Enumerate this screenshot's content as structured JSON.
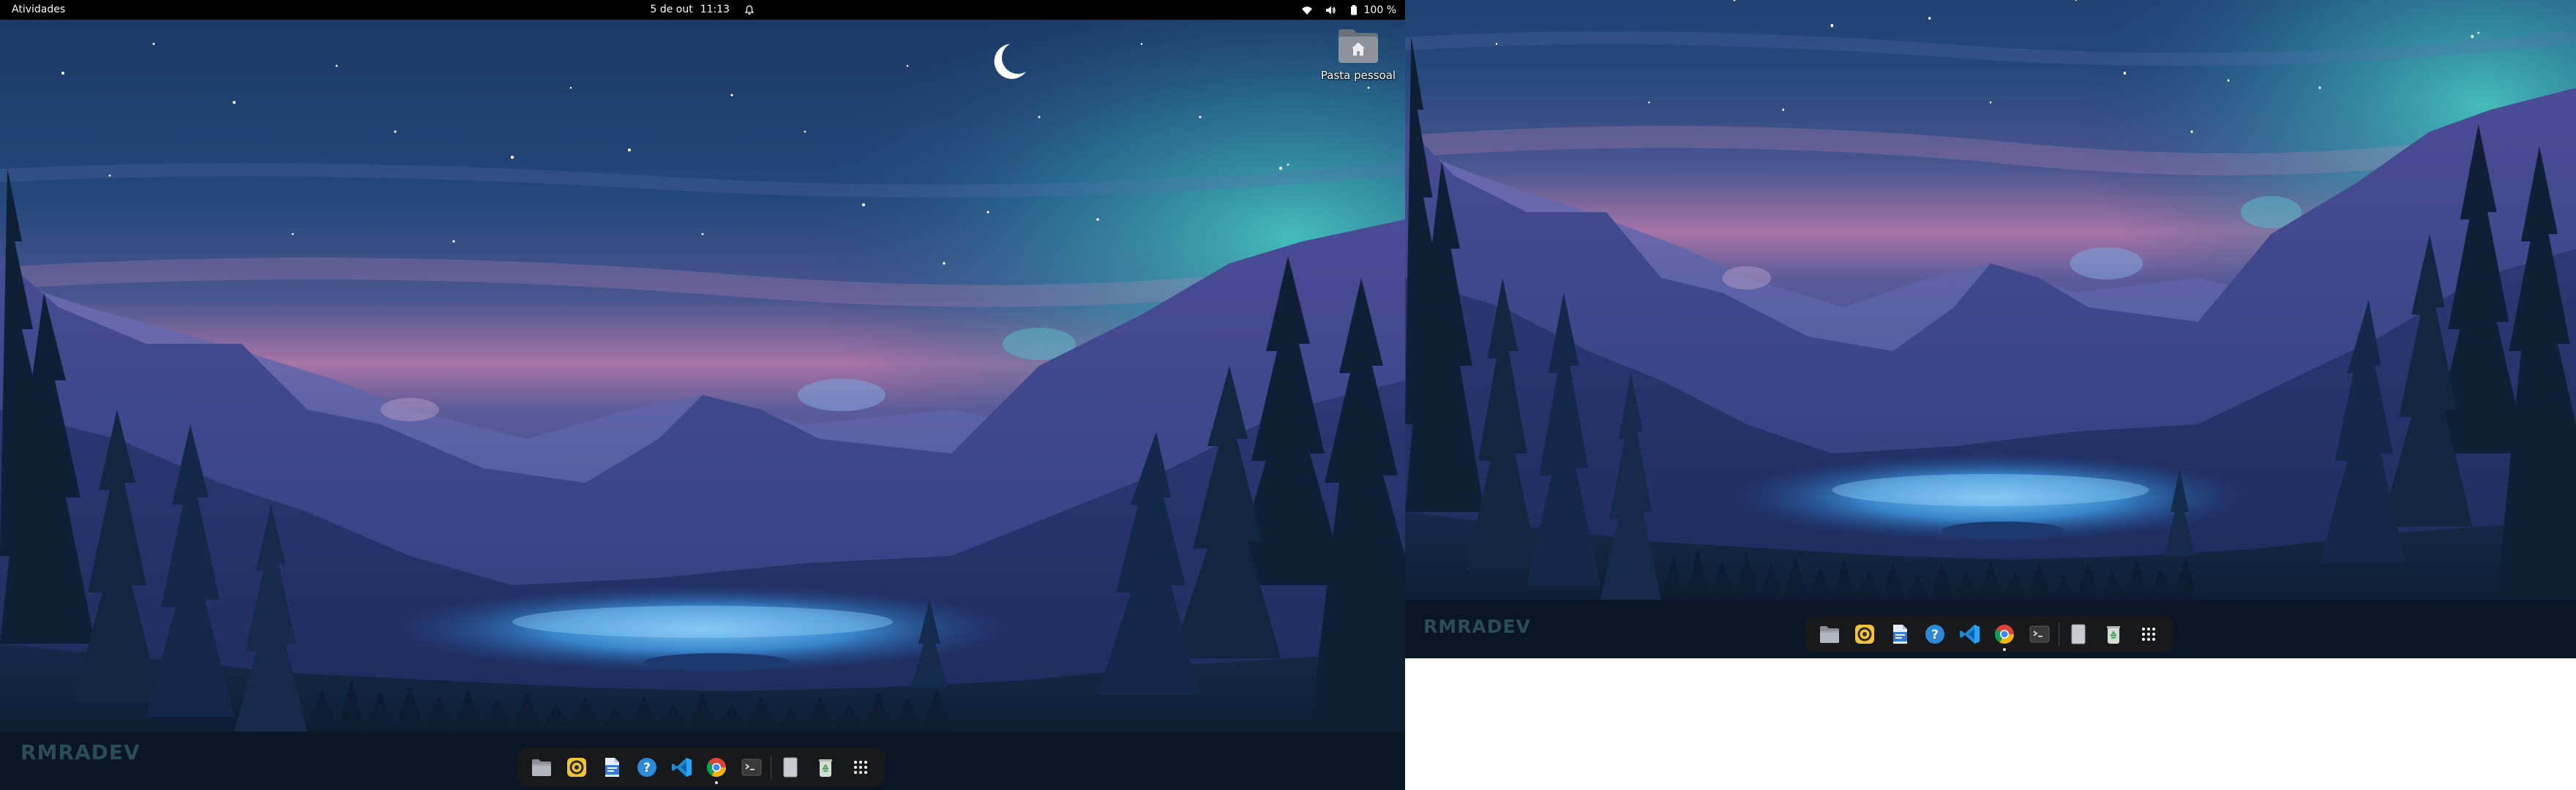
{
  "topbar": {
    "activities_label": "Atividades",
    "date": "5 de out",
    "time": "11:13",
    "battery_label": "100 %"
  },
  "desktop": {
    "home_folder_label": "Pasta pessoal"
  },
  "watermark": {
    "text": "RMRADEV"
  },
  "dock": {
    "items": [
      {
        "icon": "files-icon"
      },
      {
        "icon": "rhythmbox-icon"
      },
      {
        "icon": "document-editor-icon"
      },
      {
        "icon": "help-icon"
      },
      {
        "icon": "vscode-icon"
      },
      {
        "icon": "chrome-icon",
        "running": true
      },
      {
        "icon": "terminal-icon"
      },
      {
        "icon": "text-editor-icon"
      },
      {
        "icon": "trash-icon"
      },
      {
        "icon": "app-grid-icon"
      }
    ]
  },
  "colors": {
    "topbar": "#000000",
    "dock_background": "#1a1a1a",
    "sky_top": "#1a3a66",
    "sky_pink": "#c47aa8",
    "aurora": "#3aa8b0",
    "lake": "#3a8fd8",
    "forest": "#0a1a2a"
  }
}
